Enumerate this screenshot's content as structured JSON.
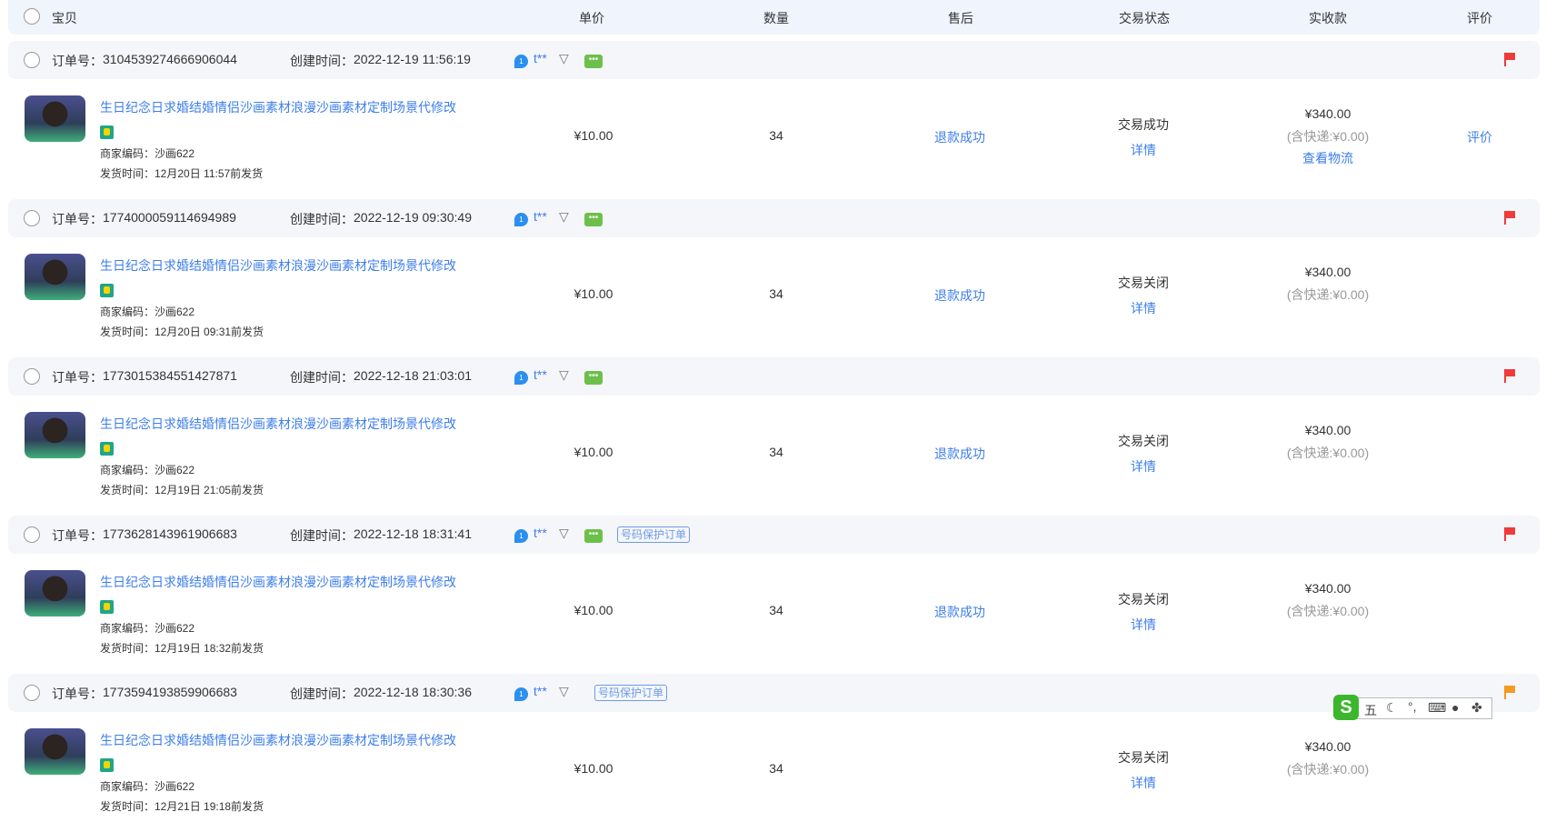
{
  "header": {
    "item": "宝贝",
    "unit_price": "单价",
    "quantity": "数量",
    "after_sale": "售后",
    "trade_status": "交易状态",
    "received": "实收款",
    "review": "评价"
  },
  "labels": {
    "order_no": "订单号：",
    "created": "创建时间：",
    "merchant_code": "商家编码：",
    "ship_time": "发货时间：",
    "details": "详情",
    "logistics": "查看物流",
    "protect_tag": "号码保护订单",
    "buyer": "t**"
  },
  "orders": [
    {
      "order_no": "3104539274666906044",
      "created": "2022-12-19 11:56:19",
      "title": "生日纪念日求婚结婚情侣沙画素材浪漫沙画素材定制场景代修改",
      "merchant_code": "沙画622",
      "ship": "12月20日 11:57前发货",
      "price": "¥10.00",
      "qty": "34",
      "after_sale": "退款成功",
      "status": "交易成功",
      "received": "¥340.00",
      "shipping": "(含快递:¥0.00)",
      "review": "评价",
      "flag_color": "#f03a3a"
    },
    {
      "order_no": "1774000059114694989",
      "created": "2022-12-19 09:30:49",
      "title": "生日纪念日求婚结婚情侣沙画素材浪漫沙画素材定制场景代修改",
      "merchant_code": "沙画622",
      "ship": "12月20日 09:31前发货",
      "price": "¥10.00",
      "qty": "34",
      "after_sale": "退款成功",
      "status": "交易关闭",
      "received": "¥340.00",
      "shipping": "(含快递:¥0.00)",
      "flag_color": "#f03a3a"
    },
    {
      "order_no": "1773015384551427871",
      "created": "2022-12-18 21:03:01",
      "title": "生日纪念日求婚结婚情侣沙画素材浪漫沙画素材定制场景代修改",
      "merchant_code": "沙画622",
      "ship": "12月19日 21:05前发货",
      "price": "¥10.00",
      "qty": "34",
      "after_sale": "退款成功",
      "status": "交易关闭",
      "received": "¥340.00",
      "shipping": "(含快递:¥0.00)",
      "flag_color": "#f03a3a"
    },
    {
      "order_no": "1773628143961906683",
      "created": "2022-12-18 18:31:41",
      "title": "生日纪念日求婚结婚情侣沙画素材浪漫沙画素材定制场景代修改",
      "merchant_code": "沙画622",
      "ship": "12月19日 18:32前发货",
      "price": "¥10.00",
      "qty": "34",
      "after_sale": "退款成功",
      "status": "交易关闭",
      "received": "¥340.00",
      "shipping": "(含快递:¥0.00)",
      "flag_color": "#f03a3a"
    },
    {
      "order_no": "1773594193859906683",
      "created": "2022-12-18 18:30:36",
      "title": "生日纪念日求婚结婚情侣沙画素材浪漫沙画素材定制场景代修改",
      "merchant_code": "沙画622",
      "ship": "12月21日 19:18前发货",
      "price": "¥10.00",
      "qty": "34",
      "after_sale": "",
      "status": "交易关闭",
      "received": "¥340.00",
      "shipping": "(含快递:¥0.00)",
      "flag_color": "#f59a23"
    }
  ],
  "ime": {
    "mode": "五",
    "icons": [
      "moon-icon",
      "punctuation-icon",
      "keyboard-icon",
      "user-icon",
      "apps-icon"
    ]
  }
}
